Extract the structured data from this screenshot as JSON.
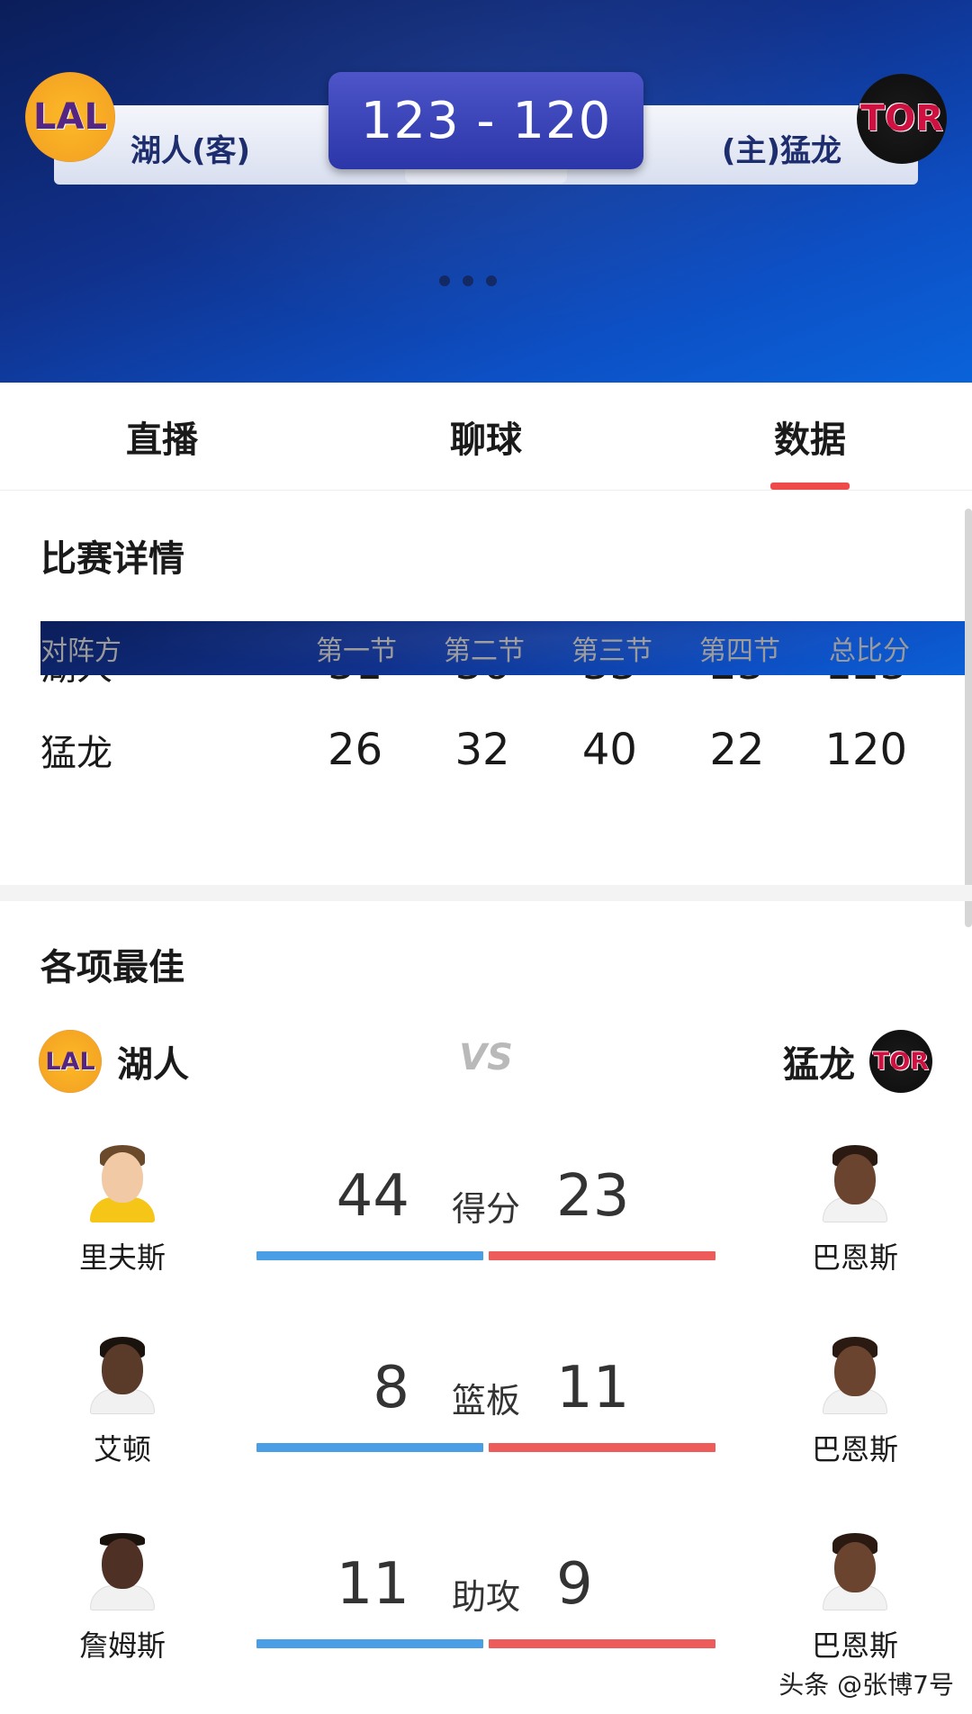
{
  "header": {
    "score": "123 - 120",
    "away_team": "湖人(客)",
    "home_team": "(主)猛龙",
    "away_logo_text": "LAL",
    "home_logo_text": "TOR"
  },
  "tabs": [
    {
      "label": "直播"
    },
    {
      "label": "聊球"
    },
    {
      "label": "数据",
      "active": true
    }
  ],
  "match_details": {
    "title": "比赛详情",
    "columns": [
      "对阵方",
      "第一节",
      "第二节",
      "第三节",
      "第四节",
      "总比分"
    ],
    "rows": [
      {
        "team": "湖人",
        "q1": "31",
        "q2": "36",
        "q3": "33",
        "q4": "23",
        "total": "123"
      },
      {
        "team": "猛龙",
        "q1": "26",
        "q2": "32",
        "q3": "40",
        "q4": "22",
        "total": "120"
      }
    ]
  },
  "best": {
    "title": "各项最佳",
    "left_team": "湖人",
    "right_team": "猛龙",
    "left_logo_text": "LAL",
    "right_logo_text": "TOR",
    "vs": "VS",
    "stats": [
      {
        "label": "得分",
        "left_player": "里夫斯",
        "left_value": "44",
        "right_player": "巴恩斯",
        "right_value": "23"
      },
      {
        "label": "篮板",
        "left_player": "艾顿",
        "left_value": "8",
        "right_player": "巴恩斯",
        "right_value": "11"
      },
      {
        "label": "助攻",
        "left_player": "詹姆斯",
        "left_value": "11",
        "right_player": "巴恩斯",
        "right_value": "9"
      }
    ]
  },
  "colors": {
    "accent_red": "#ee4a4a",
    "bar_blue": "#4a9ee6",
    "bar_red": "#ee5b5b",
    "header_blue": "#10308a"
  },
  "watermark": "头条 @张博7号"
}
